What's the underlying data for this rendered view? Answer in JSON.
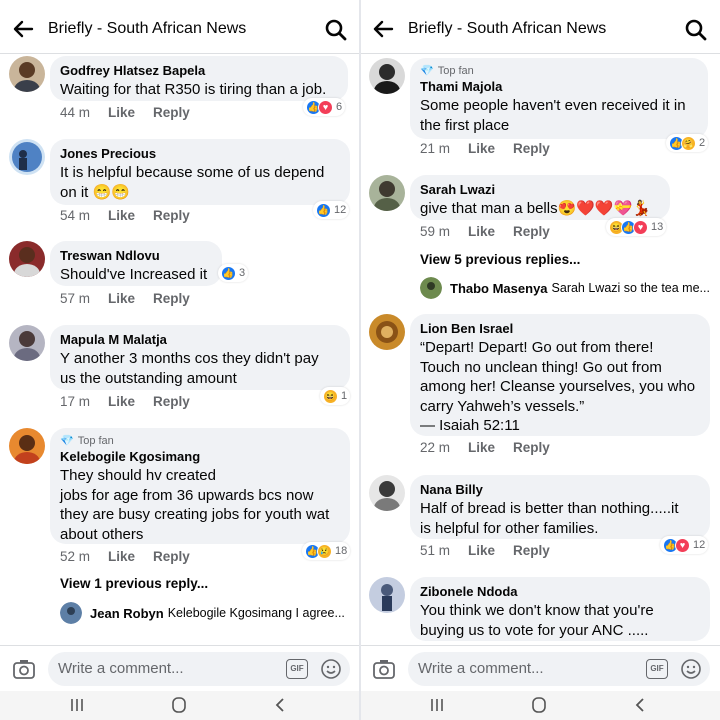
{
  "left": {
    "header": {
      "title": "Briefly - South African News"
    },
    "comments": [
      {
        "name": "Godfrey Hlatsez Bapela",
        "text": "Waiting for that R350 is tiring than a job.",
        "time": "44 m",
        "like": "Like",
        "reply": "Reply",
        "reactions": [
          "like",
          "love"
        ],
        "count": "6",
        "avatar_color": "#8a6a4e"
      },
      {
        "name": "Jones Precious",
        "text": "It is helpful because some of us depend\non it 😁😁",
        "time": "54 m",
        "like": "Like",
        "reply": "Reply",
        "reactions": [
          "like"
        ],
        "count": "12",
        "avatar_color": "#3d6fa8"
      },
      {
        "name": "Treswan Ndlovu",
        "text": "Should've Increased it",
        "time": "57 m",
        "like": "Like",
        "reply": "Reply",
        "reactions": [
          "like"
        ],
        "count": "3",
        "avatar_color": "#7a3b2e"
      },
      {
        "name": "Mapula M Malatja",
        "text": "Y another 3 months cos they didn't pay\nus the outstanding amount",
        "time": "17 m",
        "like": "Like",
        "reply": "Reply",
        "reactions": [
          "haha"
        ],
        "count": "1",
        "avatar_color": "#8c8c9c"
      },
      {
        "topfan": "Top fan",
        "name": "Kelebogile Kgosimang",
        "text": "They should hv created\n jobs for age from 36 upwards bcs now\nthey are busy creating jobs for youth wat\nabout others",
        "time": "52 m",
        "like": "Like",
        "reply": "Reply",
        "reactions": [
          "like",
          "sad"
        ],
        "count": "18",
        "avatar_color": "#d9752a"
      }
    ],
    "view_previous": "View 1 previous reply...",
    "reply_preview": {
      "name": "Jean Robyn",
      "text": "Kelebogile Kgosimang I agree..."
    },
    "composer": {
      "placeholder": "Write a comment...",
      "gif": "GIF"
    }
  },
  "right": {
    "header": {
      "title": "Briefly - South African News"
    },
    "comments": [
      {
        "topfan": "Top fan",
        "name": "Thami Majola",
        "text": "Some people haven't even received it in\nthe first place",
        "time": "21 m",
        "like": "Like",
        "reply": "Reply",
        "reactions": [
          "like",
          "care"
        ],
        "count": "2",
        "avatar_color": "#4a4a4a"
      },
      {
        "name": "Sarah Lwazi",
        "text": "give that man a bells😍❤️❤️💝💃",
        "time": "59 m",
        "like": "Like",
        "reply": "Reply",
        "reactions": [
          "haha",
          "like",
          "love"
        ],
        "count": "13",
        "avatar_color": "#6b7a5c"
      },
      {
        "name": "Lion Ben Israel",
        "text": "“Depart! Depart! Go out from there!\nTouch no unclean thing! Go out from\namong her! Cleanse yourselves, you who\ncarry Yahweh’s vessels.”\n — Isaiah 52:11",
        "time": "22 m",
        "like": "Like",
        "reply": "Reply",
        "reactions": [],
        "count": "",
        "avatar_color": "#b07a2a"
      },
      {
        "name": "Nana Billy",
        "text": "Half of bread is better than nothing.....it\nis helpful for other families.",
        "time": "51 m",
        "like": "Like",
        "reply": "Reply",
        "reactions": [
          "like",
          "love"
        ],
        "count": "12",
        "avatar_color": "#9a9a9a"
      },
      {
        "name": "Zibonele Ndoda",
        "text": "You think we don't know that you're\nbuying us to vote for your ANC .....",
        "avatar_color": "#7d8fb0"
      }
    ],
    "view_previous": "View 5 previous replies...",
    "reply_preview": {
      "name": "Thabo Masenya",
      "text": "Sarah Lwazi so the tea me..."
    },
    "composer": {
      "placeholder": "Write a comment...",
      "gif": "GIF"
    }
  },
  "colors": {
    "bubble": "#f0f2f5",
    "like": "#1877f2",
    "love": "#f33e58",
    "muted": "#65676b"
  }
}
